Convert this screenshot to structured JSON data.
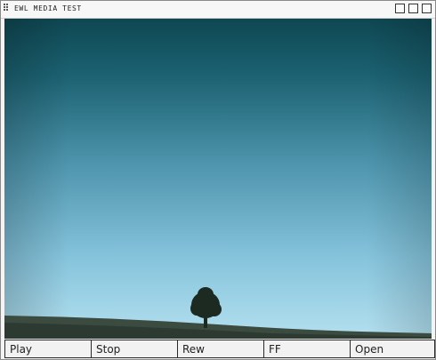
{
  "window": {
    "title": "EWL MEDIA TEST"
  },
  "controls": {
    "play_label": "Play",
    "stop_label": "Stop",
    "rew_label": "Rew",
    "ff_label": "FF",
    "open_label": "Open"
  },
  "colors": {
    "sky_top": "#0e4752",
    "sky_mid": "#4e98b0",
    "sky_bottom": "#a9d9ea",
    "ground": "#3a4a3e",
    "button_face": "#f2f2f2",
    "button_border": "#2a2a2a"
  }
}
